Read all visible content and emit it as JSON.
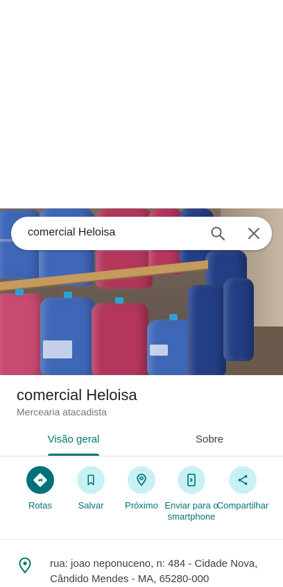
{
  "search": {
    "query": "comercial Heloisa"
  },
  "place": {
    "name": "comercial Heloisa",
    "category": "Mercearia atacadista"
  },
  "tabs": [
    {
      "label": "Visão geral",
      "active": true
    },
    {
      "label": "Sobre",
      "active": false
    }
  ],
  "actions": [
    {
      "label": "Rotas",
      "icon": "directions-icon"
    },
    {
      "label": "Salvar",
      "icon": "bookmark-icon"
    },
    {
      "label": "Próximo",
      "icon": "nearby-icon"
    },
    {
      "label": "Enviar para o smartphone",
      "icon": "send-to-phone-icon"
    },
    {
      "label": "Compartilhar",
      "icon": "share-icon"
    }
  ],
  "address": {
    "icon": "location-pin-icon",
    "text": "rua: joao neponuceno, n: 484 - Cidade Nova, Cândido Mendes - MA, 65280-000"
  },
  "colors": {
    "accent": "#00796b",
    "action_bg": "#c8f1f5",
    "action_primary": "#00717a"
  }
}
